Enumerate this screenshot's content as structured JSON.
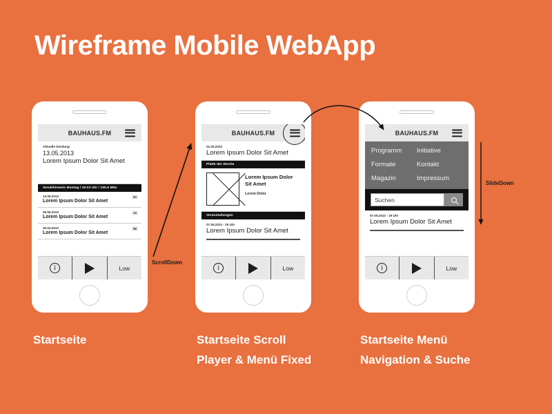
{
  "meta": {
    "title": "Wireframe Mobile WebApp",
    "background_color": "#E9703F",
    "accent_color": "#FFFFFF"
  },
  "brand": "BAUHAUS.FM",
  "icons": {
    "hamburger": "hamburger-menu-icon",
    "info": "i",
    "play": "play-icon",
    "search": "search-icon"
  },
  "player": {
    "info_label": "i",
    "quality_label": "Low"
  },
  "phone1": {
    "now_playing": {
      "kicker": "Aktuelle Sendung",
      "date": "13.05.2013",
      "title": "Lorem Ipsum Dolor Sit Amet"
    },
    "notice_bar": "Sendehinweis Montag / 19-23 Uhr / 105.6 MHz",
    "rows": [
      {
        "date": "13.05.2013",
        "title": "Lorem Ipsum Dolor Sit Amet",
        "badge": "24"
      },
      {
        "date": "06.05.2013",
        "title": "Lorem Ipsum Dolor Sit Amet",
        "badge": "14"
      },
      {
        "date": "30.04.2013",
        "title": "Lorem Ipsum Dolor Sit Amet",
        "badge": "08"
      }
    ]
  },
  "phone2": {
    "top_entry": {
      "date": "01.05.2013",
      "title": "Lorem Ipsum Dolor Sit Amet"
    },
    "section_record": "Platte der Woche",
    "record": {
      "title": "Lorem Ipsum Dolor Sit Amet",
      "subtitle": "Lorem Dolor"
    },
    "section_events": "Veranstaltungen",
    "event": {
      "date": "07.05.2013 - 19 Uhr",
      "title": "Lorem Ipsum Dolor Sit Amet"
    }
  },
  "phone3": {
    "menu_items": [
      "Programm",
      "Initiative",
      "Formate",
      "Kontakt",
      "Magazin",
      "Impressum"
    ],
    "search": {
      "value": "Suchen",
      "placeholder": "Suchen"
    },
    "event": {
      "date": "07.05.2013 - 19 Uhr",
      "title": "Lorem Ipsum Dolor Sit Amet"
    }
  },
  "annotations": {
    "scroll_down": "ScrollDown",
    "slide_down": "SlideDown"
  },
  "captions": {
    "phone1": "Startseite",
    "phone2": "Startseite Scroll\nPlayer & Menü Fixed",
    "phone3": "Startseite Menü\nNavigation & Suche"
  }
}
